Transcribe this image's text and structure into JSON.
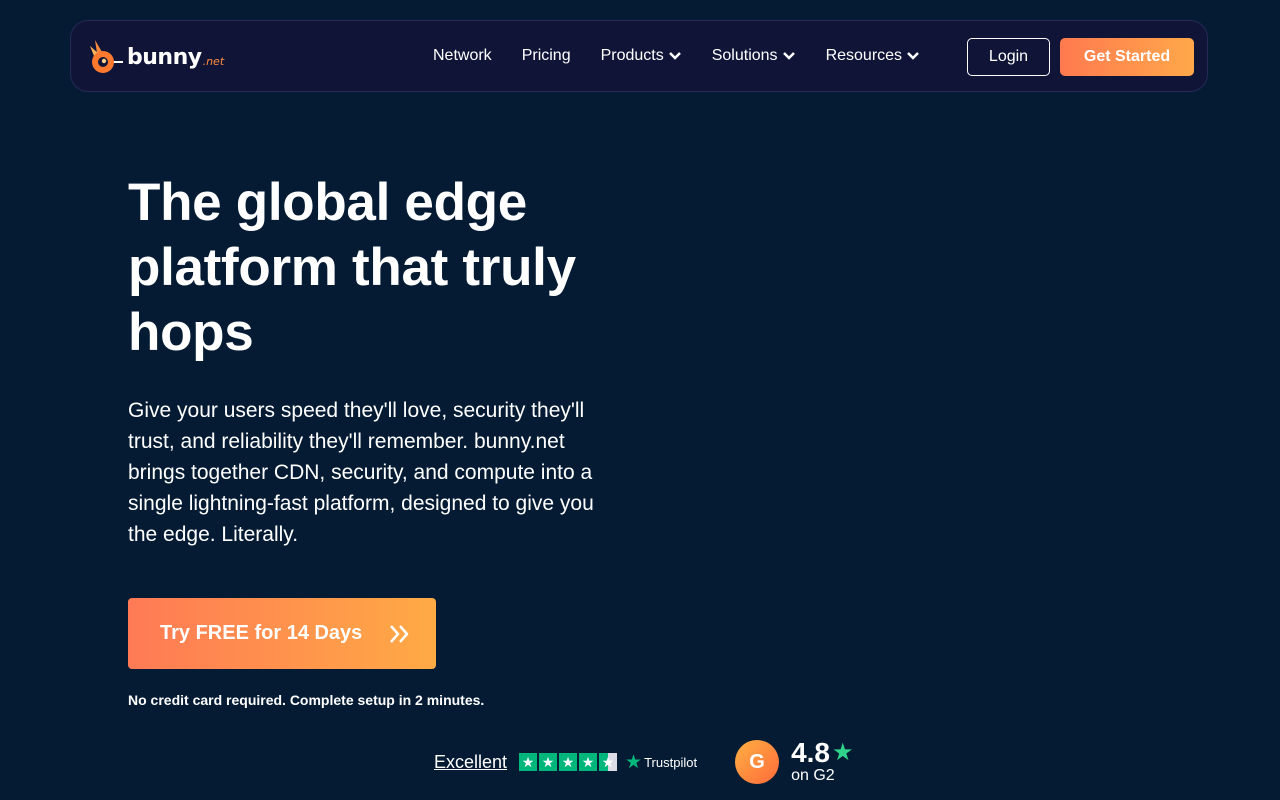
{
  "header": {
    "logo_text": "bunny",
    "logo_tld": ".net",
    "nav": [
      {
        "label": "Network"
      },
      {
        "label": "Pricing"
      },
      {
        "label": "Products"
      },
      {
        "label": "Solutions"
      },
      {
        "label": "Resources"
      }
    ],
    "login_label": "Login",
    "get_started_label": "Get Started"
  },
  "hero": {
    "title": "The global edge platform that truly hops",
    "description": "Give your users speed they'll love, security they'll trust, and reliability they'll remember. bunny.net brings together CDN, security, and compute into a single lightning-fast platform, designed to give you the edge. Literally.",
    "cta_label": "Try FREE for 14 Days",
    "cta_note": "No credit card required. Complete setup in 2 minutes."
  },
  "ratings": {
    "trustpilot_label": "Excellent",
    "trustpilot_brand": "Trustpilot",
    "trustpilot_stars": 4.5,
    "g2_badge": "G",
    "g2_score": "4.8",
    "g2_suffix": "on G2"
  },
  "colors": {
    "background": "#041b33",
    "navbar": "#101538",
    "accent_start": "#ff7a4f",
    "accent_end": "#ffa84a",
    "trustpilot_green": "#00b67a",
    "g2_star_green": "#2fd38b"
  },
  "icons": [
    "bunny-logo-icon",
    "chevron-down-icon",
    "double-chevron-right-icon",
    "trustpilot-star-icon",
    "g2-logo-icon",
    "rating-star-icon"
  ]
}
